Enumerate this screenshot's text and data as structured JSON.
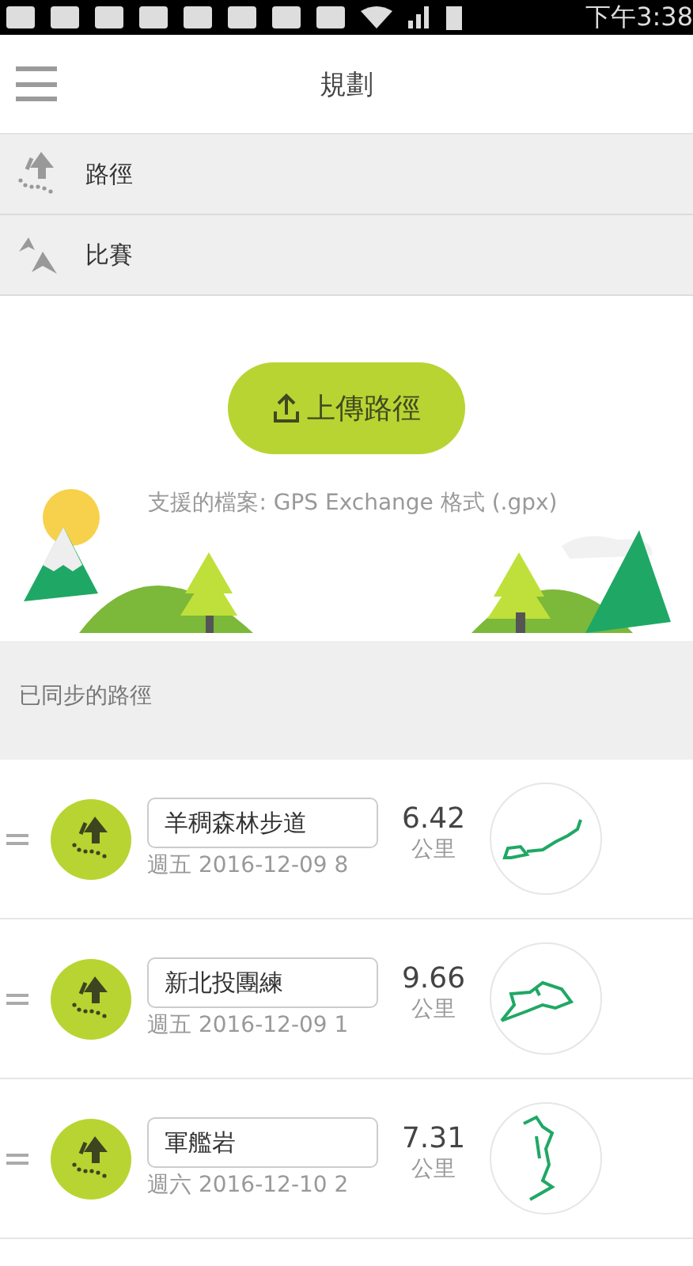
{
  "status_bar": {
    "time": "下午3:38"
  },
  "header": {
    "title": "規劃"
  },
  "menu": [
    {
      "kind": "route",
      "label": "路徑"
    },
    {
      "kind": "race",
      "label": "比賽"
    }
  ],
  "upload": {
    "button": "上傳路徑",
    "note": "支援的檔案: GPS Exchange 格式 (.gpx)"
  },
  "synced": {
    "title": "已同步的路徑"
  },
  "routes": [
    {
      "name": "羊稠森林步道",
      "date": "週五 2016-12-09 8",
      "distance": "6.42",
      "unit": "公里"
    },
    {
      "name": "新北投團練",
      "date": "週五 2016-12-09 1",
      "distance": "9.66",
      "unit": "公里"
    },
    {
      "name": "軍艦岩",
      "date": "週六 2016-12-10 2",
      "distance": "7.31",
      "unit": "公里"
    }
  ]
}
